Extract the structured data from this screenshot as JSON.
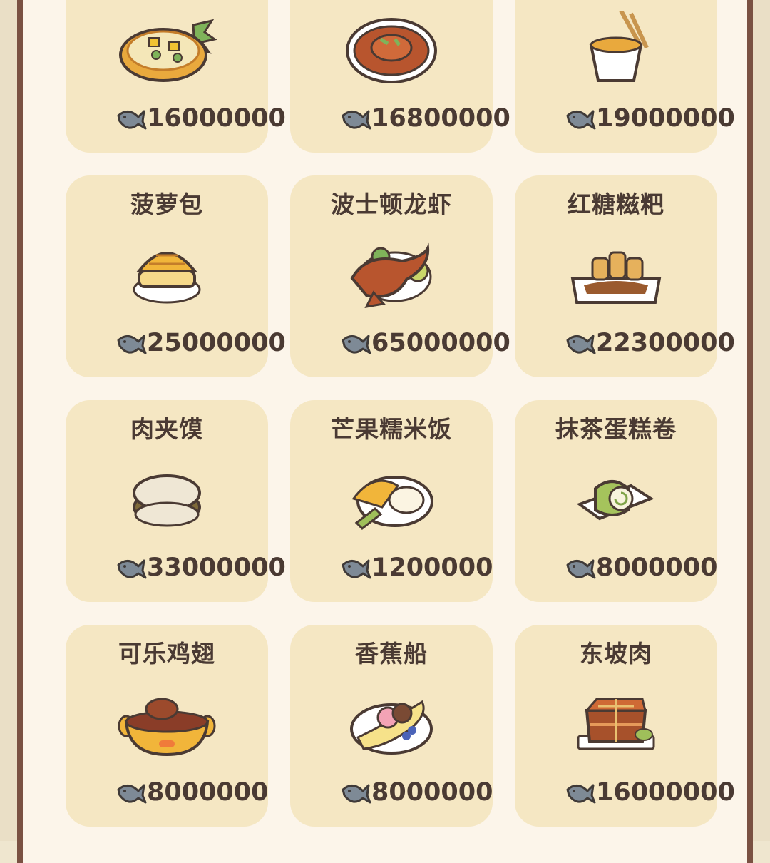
{
  "menu": {
    "items": [
      {
        "name": "",
        "price": "16000000",
        "dish_icon": "pineapple-fried-rice-icon"
      },
      {
        "name": "",
        "price": "16800000",
        "dish_icon": "crab-dish-icon"
      },
      {
        "name": "",
        "price": "19000000",
        "dish_icon": "noodle-cup-icon"
      },
      {
        "name": "菠萝包",
        "price": "25000000",
        "dish_icon": "pineapple-bun-icon"
      },
      {
        "name": "波士顿龙虾",
        "price": "65000000",
        "dish_icon": "lobster-icon"
      },
      {
        "name": "红糖糍粑",
        "price": "22300000",
        "dish_icon": "brown-sugar-ciba-icon"
      },
      {
        "name": "肉夹馍",
        "price": "33000000",
        "dish_icon": "roujiamo-icon"
      },
      {
        "name": "芒果糯米饭",
        "price": "1200000",
        "dish_icon": "mango-sticky-rice-icon"
      },
      {
        "name": "抹茶蛋糕卷",
        "price": "8000000",
        "dish_icon": "matcha-roll-icon"
      },
      {
        "name": "可乐鸡翅",
        "price": "8000000",
        "dish_icon": "cola-chicken-wings-icon"
      },
      {
        "name": "香蕉船",
        "price": "8000000",
        "dish_icon": "banana-split-icon"
      },
      {
        "name": "东坡肉",
        "price": "16000000",
        "dish_icon": "dongpo-pork-icon"
      }
    ]
  },
  "currency_icon": "fish-icon",
  "colors": {
    "card": "#f5e7c3",
    "panel": "#fcf5ea",
    "border": "#7a5142",
    "text": "#4a3a33",
    "fish": "#7e8a96"
  }
}
